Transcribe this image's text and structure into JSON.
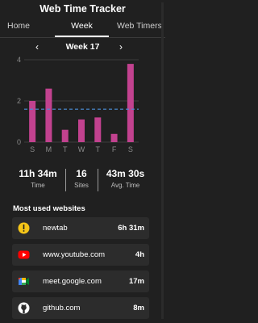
{
  "header": {
    "title": "Web Time Tracker"
  },
  "tabs": [
    {
      "label": "Home"
    },
    {
      "label": "Week"
    },
    {
      "label": "Web Timers"
    }
  ],
  "week_nav": {
    "prev": "‹",
    "label": "Week 17",
    "next": "›"
  },
  "chart_data": {
    "type": "bar",
    "categories": [
      "S",
      "M",
      "T",
      "W",
      "T",
      "F",
      "S"
    ],
    "values": [
      2.0,
      2.6,
      0.6,
      1.1,
      1.2,
      0.4,
      3.8
    ],
    "ylim": [
      0,
      4
    ],
    "yticks": [
      0,
      2,
      4
    ],
    "average_line": 1.6,
    "grid": true,
    "bar_color": "#c2428f",
    "average_color": "#4a90d9"
  },
  "stats": {
    "time": {
      "value": "11h 34m",
      "label": "Time"
    },
    "sites": {
      "value": "16",
      "label": "Sites"
    },
    "avg": {
      "value": "43m 30s",
      "label": "Avg. Time"
    }
  },
  "most_used": {
    "title": "Most used websites",
    "items": [
      {
        "icon": "warning-icon",
        "name": "newtab",
        "duration": "6h 31m"
      },
      {
        "icon": "youtube-icon",
        "name": "www.youtube.com",
        "duration": "4h"
      },
      {
        "icon": "google-meet-icon",
        "name": "meet.google.com",
        "duration": "17m"
      },
      {
        "icon": "github-icon",
        "name": "github.com",
        "duration": "8m"
      }
    ]
  },
  "colors": {
    "background": "#202020",
    "row": "#2c2c2c",
    "accent": "#c2428f",
    "avg": "#4a90d9"
  }
}
